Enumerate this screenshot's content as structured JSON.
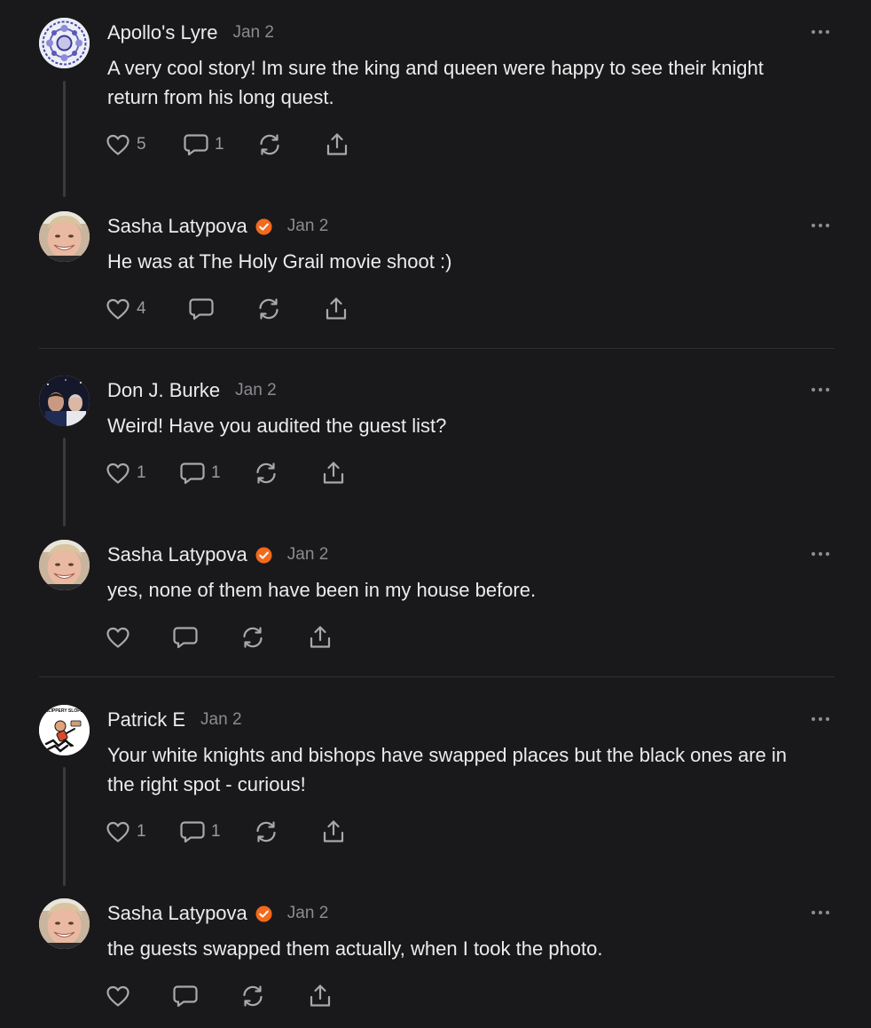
{
  "colors": {
    "background": "#19191b",
    "text": "#ececec",
    "muted": "#8b8b90",
    "verified": "#f26a1b",
    "divider": "#2f2f32"
  },
  "comments": [
    {
      "author": "Apollo's Lyre",
      "verified": false,
      "date": "Jan 2",
      "text": "A very cool story! Im sure the king and queen were happy to see their knight return from his long quest.",
      "likes": "5",
      "replies": "1",
      "avatar": "mandala-pattern-avatar"
    },
    {
      "author": "Sasha Latypova",
      "verified": true,
      "date": "Jan 2",
      "text": "He was at The Holy Grail movie shoot :)",
      "likes": "4",
      "replies": "",
      "avatar": "smiling-woman-avatar"
    },
    {
      "author": "Don J. Burke",
      "verified": false,
      "date": "Jan 2",
      "text": "Weird! Have you audited the guest list?",
      "likes": "1",
      "replies": "1",
      "avatar": "two-people-photo-avatar"
    },
    {
      "author": "Sasha Latypova",
      "verified": true,
      "date": "Jan 2",
      "text": "yes, none of them have been in my house before.",
      "likes": "",
      "replies": "",
      "avatar": "smiling-woman-avatar"
    },
    {
      "author": "Patrick E",
      "verified": false,
      "date": "Jan 2",
      "text": "Your white knights and bishops have swapped places but the black ones are in the right spot - curious!",
      "likes": "1",
      "replies": "1",
      "avatar": "slippery-slope-cartoon-avatar",
      "avatar_caption": "SLIPPERY SLOPE"
    },
    {
      "author": "Sasha Latypova",
      "verified": true,
      "date": "Jan 2",
      "text": "the guests swapped them actually, when I took the photo.",
      "likes": "",
      "replies": "",
      "avatar": "smiling-woman-avatar"
    }
  ]
}
